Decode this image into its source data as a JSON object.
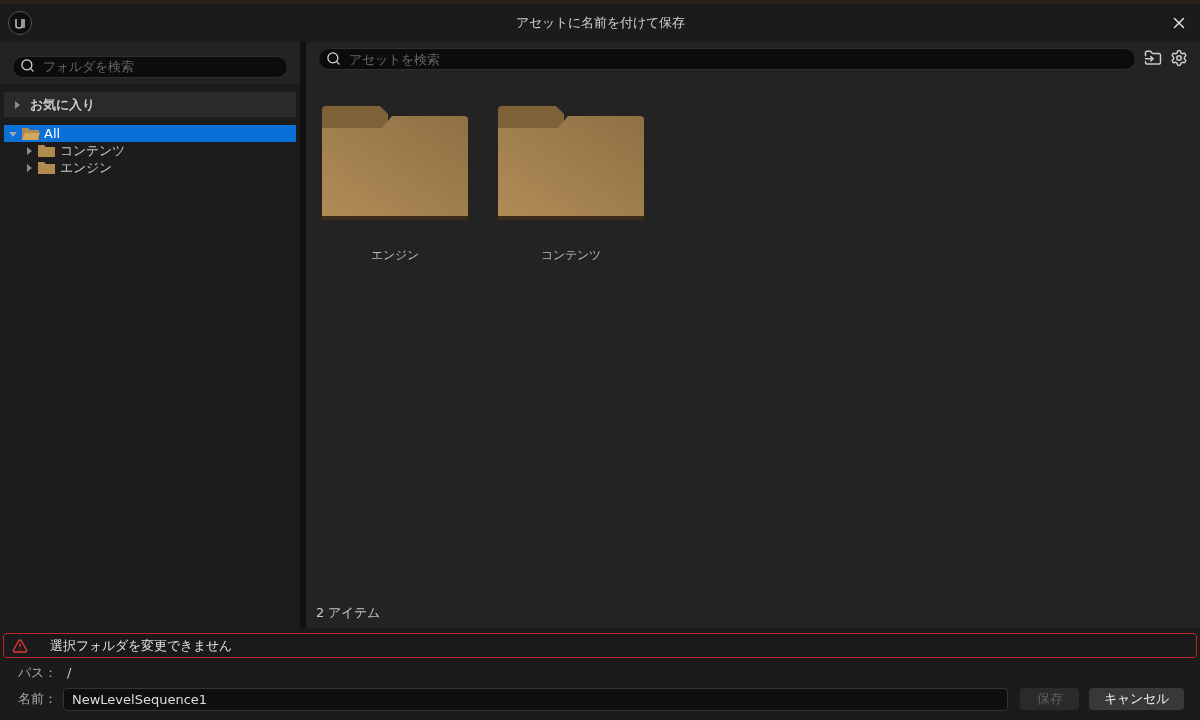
{
  "window": {
    "title": "アセットに名前を付けて保存"
  },
  "folder_search": {
    "placeholder": "フォルダを検索"
  },
  "favorites": {
    "label": "お気に入り",
    "expanded": false
  },
  "tree": [
    {
      "label": "All",
      "selected": true,
      "expanded": true,
      "children": [
        {
          "label": "コンテンツ",
          "selected": false,
          "expanded": false
        },
        {
          "label": "エンジン",
          "selected": false,
          "expanded": false
        }
      ]
    }
  ],
  "asset_search": {
    "placeholder": "アセットを検索"
  },
  "assets": [
    {
      "label": "エンジン"
    },
    {
      "label": "コンテンツ"
    }
  ],
  "item_count": "2 アイテム",
  "error": {
    "message": "選択フォルダを変更できません"
  },
  "path": {
    "label": "パス：",
    "value": "/"
  },
  "name": {
    "label": "名前：",
    "value": "NewLevelSequence1"
  },
  "buttons": [
    {
      "label": "保存",
      "disabled": true
    },
    {
      "label": "キャンセル",
      "disabled": false
    }
  ]
}
